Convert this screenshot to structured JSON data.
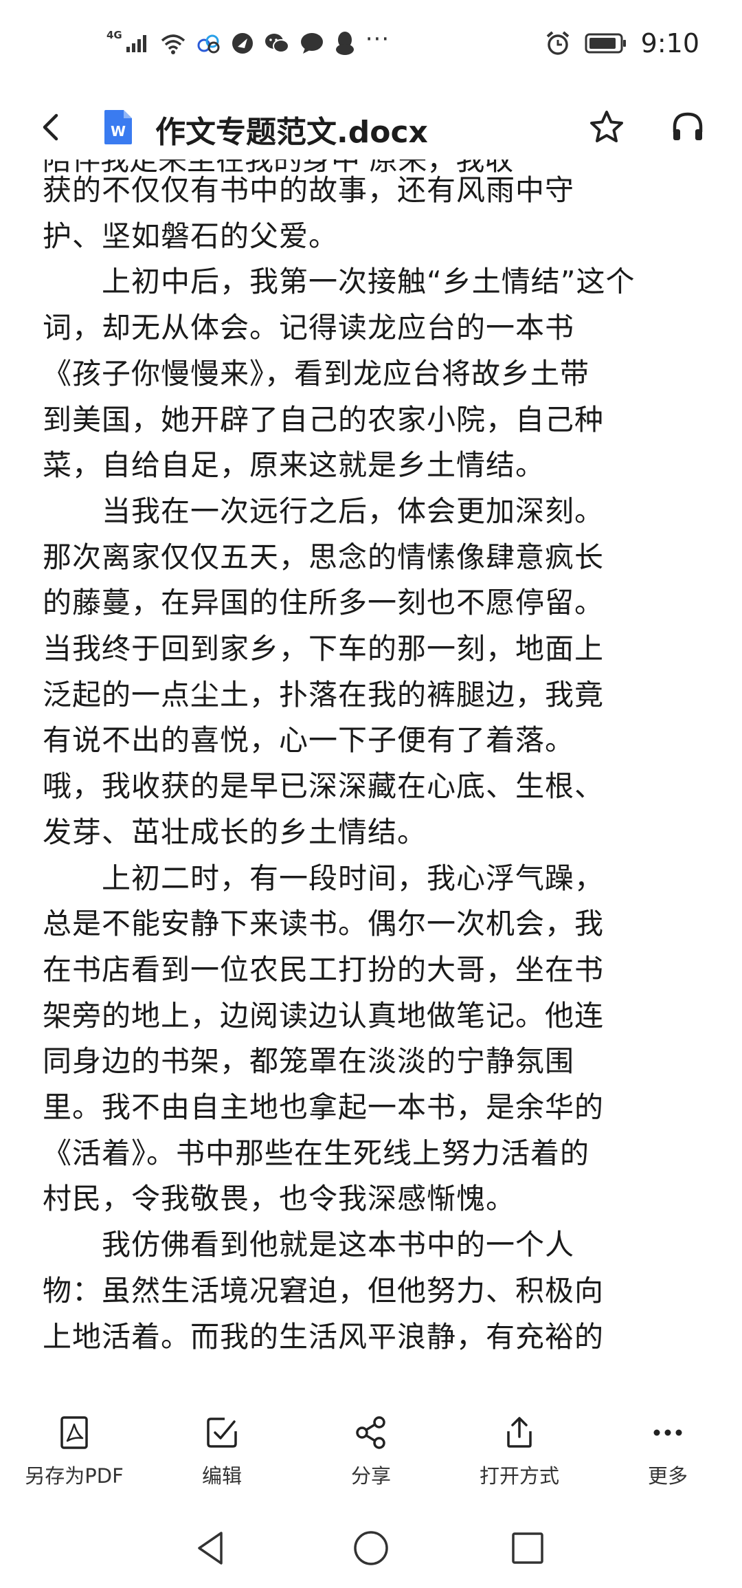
{
  "status_bar": {
    "network": "4G",
    "time": "9:10",
    "more_indicator": "···",
    "icons": [
      "signal-icon",
      "wifi-icon",
      "cloud-app-icon",
      "browser-app-icon",
      "wechat-icon",
      "message-icon",
      "qq-icon",
      "alarm-icon",
      "battery-icon"
    ]
  },
  "header": {
    "title": "作文专题范文.docx",
    "doc_icon_letter": "W",
    "icons": [
      "back-icon",
      "word-doc-icon",
      "star-icon",
      "headphones-icon"
    ]
  },
  "document": {
    "cut_off_top_line": "陪伴我走来坐在我的身中        原来，我收",
    "lines": [
      "获的不仅仅有书中的故事，还有风雨中守",
      "护、坚如磐石的父爱。",
      "　　上初中后，我第一次接触“乡土情结”这个",
      "词，却无从体会。记得读龙应台的一本书",
      "《孩子你慢慢来》，看到龙应台将故乡土带",
      "到美国，她开辟了自己的农家小院，自己种",
      "菜，自给自足，原来这就是乡土情结。",
      "　　当我在一次远行之后，体会更加深刻。",
      "那次离家仅仅五天，思念的情愫像肆意疯长",
      "的藤蔓，在异国的住所多一刻也不愿停留。",
      "当我终于回到家乡，下车的那一刻，地面上",
      "泛起的一点尘土，扑落在我的裤腿边，我竟",
      "有说不出的喜悦，心一下子便有了着落。",
      "哦，我收获的是早已深深藏在心底、生根、",
      "发芽、茁壮成长的乡土情结。",
      "　　上初二时，有一段时间，我心浮气躁，",
      "总是不能安静下来读书。偶尔一次机会，我",
      "在书店看到一位农民工打扮的大哥，坐在书",
      "架旁的地上，边阅读边认真地做笔记。他连",
      "同身边的书架，都笼罩在淡淡的宁静氛围",
      "里。我不由自主地也拿起一本书，是余华的",
      "《活着》。书中那些在生死线上努力活着的",
      "村民，令我敬畏，也令我深感惭愧。",
      "　　我仿佛看到他就是这本书中的一个人",
      "物：虽然生活境况窘迫，但他努力、积极向",
      "上地活着。而我的生活风平浪静，有充裕的"
    ]
  },
  "toolbar": {
    "items": [
      {
        "label": "另存为PDF",
        "icon": "pdf-icon"
      },
      {
        "label": "编辑",
        "icon": "edit-icon"
      },
      {
        "label": "分享",
        "icon": "share-icon"
      },
      {
        "label": "打开方式",
        "icon": "open-with-icon"
      },
      {
        "label": "更多",
        "icon": "more-icon"
      }
    ]
  },
  "navbar": {
    "icons": [
      "nav-back-icon",
      "nav-home-icon",
      "nav-recents-icon"
    ]
  }
}
